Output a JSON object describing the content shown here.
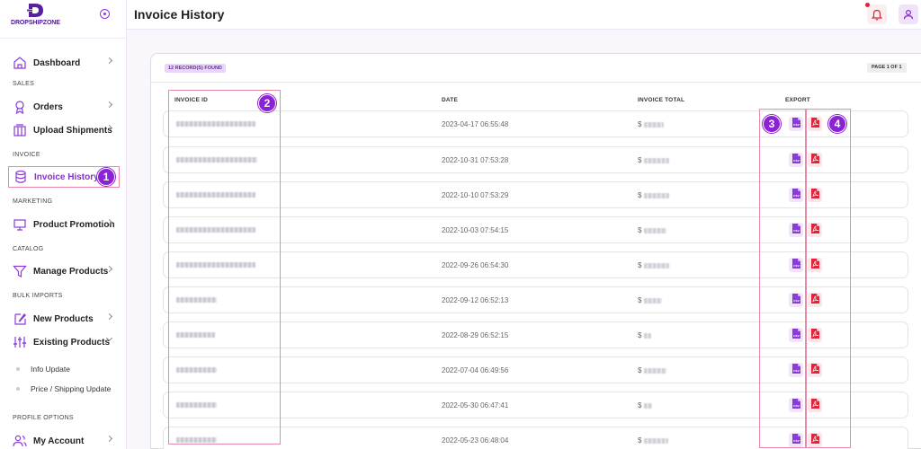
{
  "brand": {
    "logo_text": "DROPSHIPZONE"
  },
  "header": {
    "title": "Invoice History"
  },
  "sidebar": {
    "items": [
      {
        "type": "item",
        "label": "Dashboard",
        "icon": "home-icon",
        "chevron": "right"
      },
      {
        "type": "section",
        "label": "SALES"
      },
      {
        "type": "item",
        "label": "Orders",
        "icon": "award-icon",
        "chevron": "right"
      },
      {
        "type": "item",
        "label": "Upload Shipments",
        "icon": "box-icon",
        "chevron": "right"
      },
      {
        "type": "section",
        "label": "INVOICE"
      },
      {
        "type": "item",
        "label": "Invoice History",
        "icon": "database-icon",
        "active": true
      },
      {
        "type": "section",
        "label": "MARKETING"
      },
      {
        "type": "item",
        "label": "Product Promotion",
        "icon": "monitor-icon",
        "chevron": "right"
      },
      {
        "type": "section",
        "label": "CATALOG"
      },
      {
        "type": "item",
        "label": "Manage Products",
        "icon": "filter-icon",
        "chevron": "right"
      },
      {
        "type": "section",
        "label": "BULK IMPORTS"
      },
      {
        "type": "item",
        "label": "New Products",
        "icon": "edit-icon",
        "chevron": "right"
      },
      {
        "type": "item",
        "label": "Existing Products",
        "icon": "sliders-icon",
        "chevron": "down"
      },
      {
        "type": "sub",
        "label": "Info Update"
      },
      {
        "type": "sub",
        "label": "Price / Shipping Update"
      },
      {
        "type": "section",
        "label": "PROFILE OPTIONS"
      },
      {
        "type": "item",
        "label": "My Account",
        "icon": "users-icon",
        "chevron": "right"
      }
    ]
  },
  "table": {
    "records_found": "12 RECORD(S) FOUND",
    "pagination": "PAGE 1 OF 1",
    "headers": {
      "invoice_id": "INVOICE ID",
      "date": "DATE",
      "invoice_total": "INVOICE TOTAL",
      "export": "EXPORT"
    },
    "currency_symbol": "$",
    "rows": [
      {
        "date": "2023-04-17 06:55:48"
      },
      {
        "date": "2022-10-31 07:53:28"
      },
      {
        "date": "2022-10-10 07:53:29"
      },
      {
        "date": "2022-10-03 07:54:15"
      },
      {
        "date": "2022-09-26 06:54:30"
      },
      {
        "date": "2022-09-12 06:52:13"
      },
      {
        "date": "2022-08-29 06:52:15"
      },
      {
        "date": "2022-07-04 06:49:56"
      },
      {
        "date": "2022-05-30 06:47:41"
      },
      {
        "date": "2022-05-23 06:48:04"
      }
    ]
  },
  "annotations": [
    "1",
    "2",
    "3",
    "4"
  ],
  "icons": {
    "csv": "csv-file-icon",
    "pdf": "pdf-file-icon",
    "bell": "bell-icon",
    "user": "user-icon"
  },
  "colors": {
    "accent": "#8b22d6",
    "highlight": "#e68aa8",
    "pdf": "#e0243a",
    "csv": "#8b3bd9"
  }
}
